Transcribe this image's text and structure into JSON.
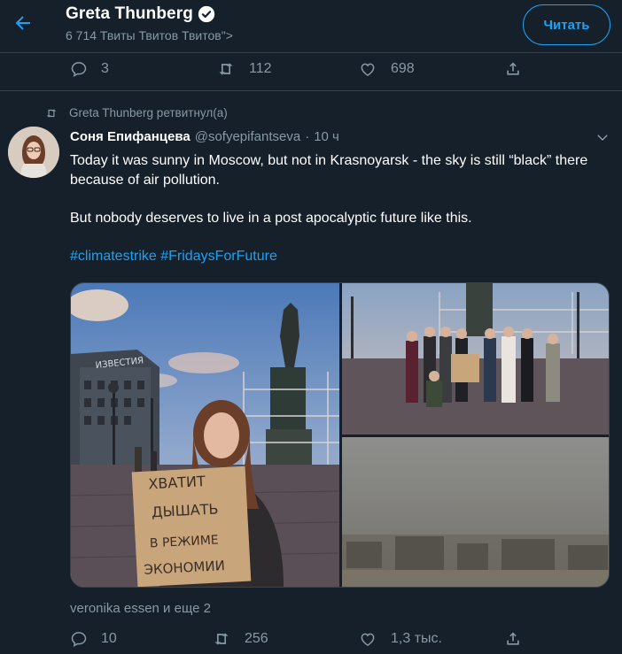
{
  "header": {
    "title": "Greta Thunberg",
    "verified_icon": "verified-badge-icon",
    "subtitle": "6 714 Твиты Твитов Твитов\">",
    "follow_label": "Читать",
    "accent": "#1da1f2"
  },
  "prev_tweet_actions": {
    "replies": "3",
    "retweets": "112",
    "likes": "698"
  },
  "retweet_info": "Greta Thunberg ретвитнул(а)",
  "tweet": {
    "author_name": "Соня Епифанцева",
    "author_handle": "@sofyepifantseva",
    "dot": "·",
    "time": "10 ч",
    "paragraph1": "Today it was sunny in Moscow, but not in Krasnoyarsk - the sky is still “black” there because of air pollution.",
    "paragraph2": "But nobody deserves to live in a post apocalyptic future like this.",
    "hashtags": "#climatestrike #FridaysForFuture",
    "sign_text": {
      "line1": "ХВАТИТ",
      "line2": "ДЫШАТЬ",
      "line3": "В РЕЖИМЕ",
      "line4": "ЭКОНОМИИ"
    },
    "building_sign": "ИЗВЕСТИЯ",
    "likers": "veronika essen и еще 2",
    "replies": "10",
    "retweets": "256",
    "likes": "1,3 тыс."
  },
  "colors": {
    "background": "#15202b",
    "muted": "#8899a6",
    "border": "#38444d"
  }
}
